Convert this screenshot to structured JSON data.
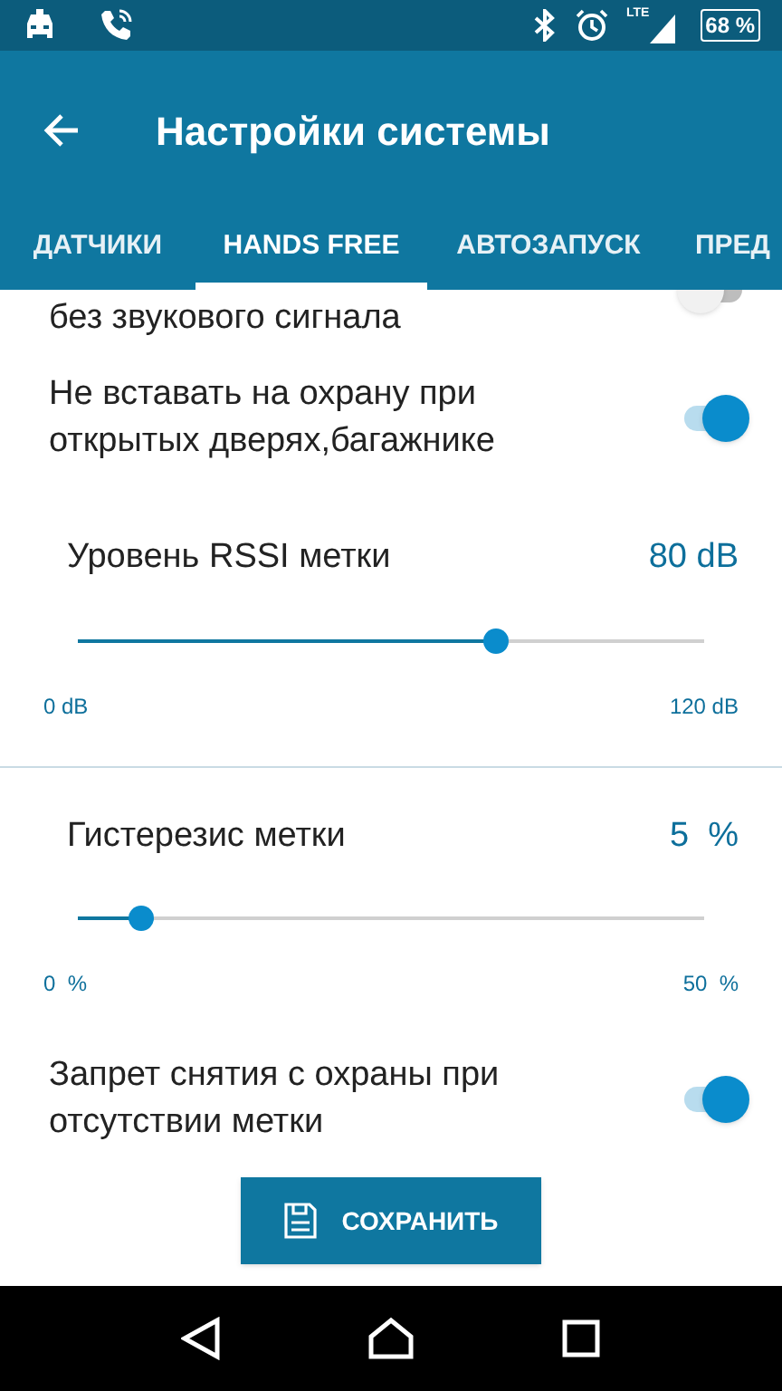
{
  "status_bar": {
    "network": "LTE",
    "battery": "68 %"
  },
  "app_bar": {
    "title": "Настройки системы"
  },
  "tabs": [
    {
      "label": "ДАТЧИКИ",
      "selected": false
    },
    {
      "label": "HANDS FREE",
      "selected": true
    },
    {
      "label": "АВТОЗАПУСК",
      "selected": false
    },
    {
      "label": "ПРЕД",
      "selected": false
    }
  ],
  "settings": [
    {
      "kind": "toggle",
      "label": "без звукового сигнала",
      "on": false,
      "cut": true
    },
    {
      "kind": "toggle",
      "label": "Не вставать на охрану при открытых дверях,багажнике",
      "on": true
    },
    {
      "kind": "slider",
      "label": "Уровень RSSI метки",
      "reading": "80 dB",
      "level": 0.667,
      "min_label": "0 dB",
      "max_label": "120 dB",
      "divider": true
    },
    {
      "kind": "slider",
      "label": "Гистерезис метки",
      "reading": "5  %",
      "level": 0.1,
      "min_label": "0  %",
      "max_label": "50  %",
      "divider": false
    },
    {
      "kind": "toggle",
      "label": "Запрет снятия с охраны при отсутствии метки",
      "on": true
    }
  ],
  "save_button": {
    "label": "СОХРАНИТЬ"
  }
}
